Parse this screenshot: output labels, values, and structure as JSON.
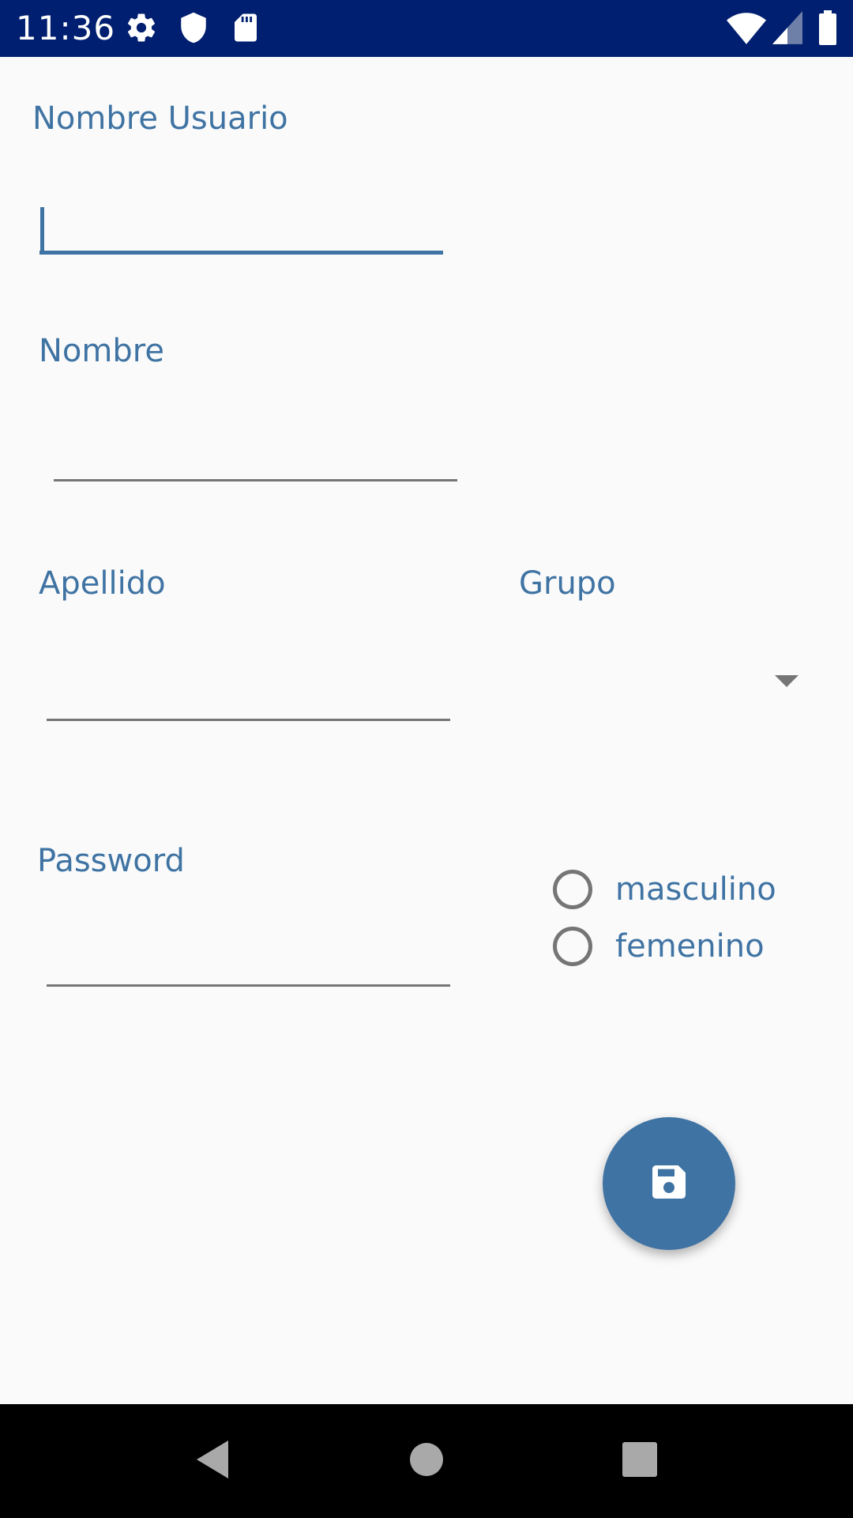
{
  "status_bar": {
    "time": "11:36",
    "icons": [
      "gear-icon",
      "shield-icon",
      "sd-card-icon",
      "wifi-icon",
      "cell-signal-icon",
      "battery-icon"
    ]
  },
  "form": {
    "username_label": "Nombre Usuario",
    "username_value": "",
    "name_label": "Nombre",
    "name_value": "",
    "lastname_label": "Apellido",
    "lastname_value": "",
    "group_label": "Grupo",
    "group_value": "",
    "password_label": "Password",
    "password_value": "",
    "gender_options": [
      "masculino",
      "femenino"
    ]
  },
  "fab": {
    "icon": "save-icon"
  },
  "nav_bar": {
    "buttons": [
      "back-icon",
      "home-icon",
      "recents-icon"
    ]
  },
  "colors": {
    "accent": "#3f73a3",
    "status_bar": "#001f70",
    "background": "#fafafa",
    "line": "#757575"
  }
}
